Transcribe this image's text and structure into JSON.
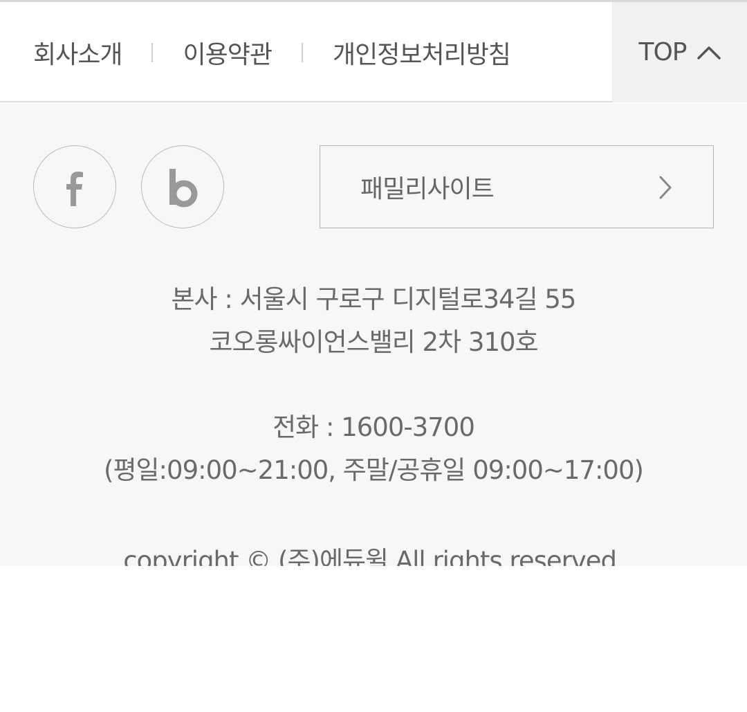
{
  "nav": {
    "links": [
      "회사소개",
      "이용약관",
      "개인정보처리방침"
    ],
    "top_label": "TOP"
  },
  "sns": {
    "facebook_icon": "facebook-icon",
    "blog_icon": "blog-icon"
  },
  "family_site": {
    "label": "패밀리사이트",
    "icon": "chevron-right-icon"
  },
  "company": {
    "address_line1": "본사 : 서울시 구로구 디지털로34길 55",
    "address_line2": "코오롱싸이언스밸리 2차 310호",
    "phone": "전화 : 1600-3700",
    "hours": "(평일:09:00~21:00, 주말/공휴일 09:00~17:00)",
    "copyright": "copyright © (주)에듀윌 All rights reserved."
  },
  "colors": {
    "footer_background": "#f7f7f7",
    "top_button_background": "#f2f2f2",
    "text": "#666666",
    "border": "#b9b9b9"
  }
}
